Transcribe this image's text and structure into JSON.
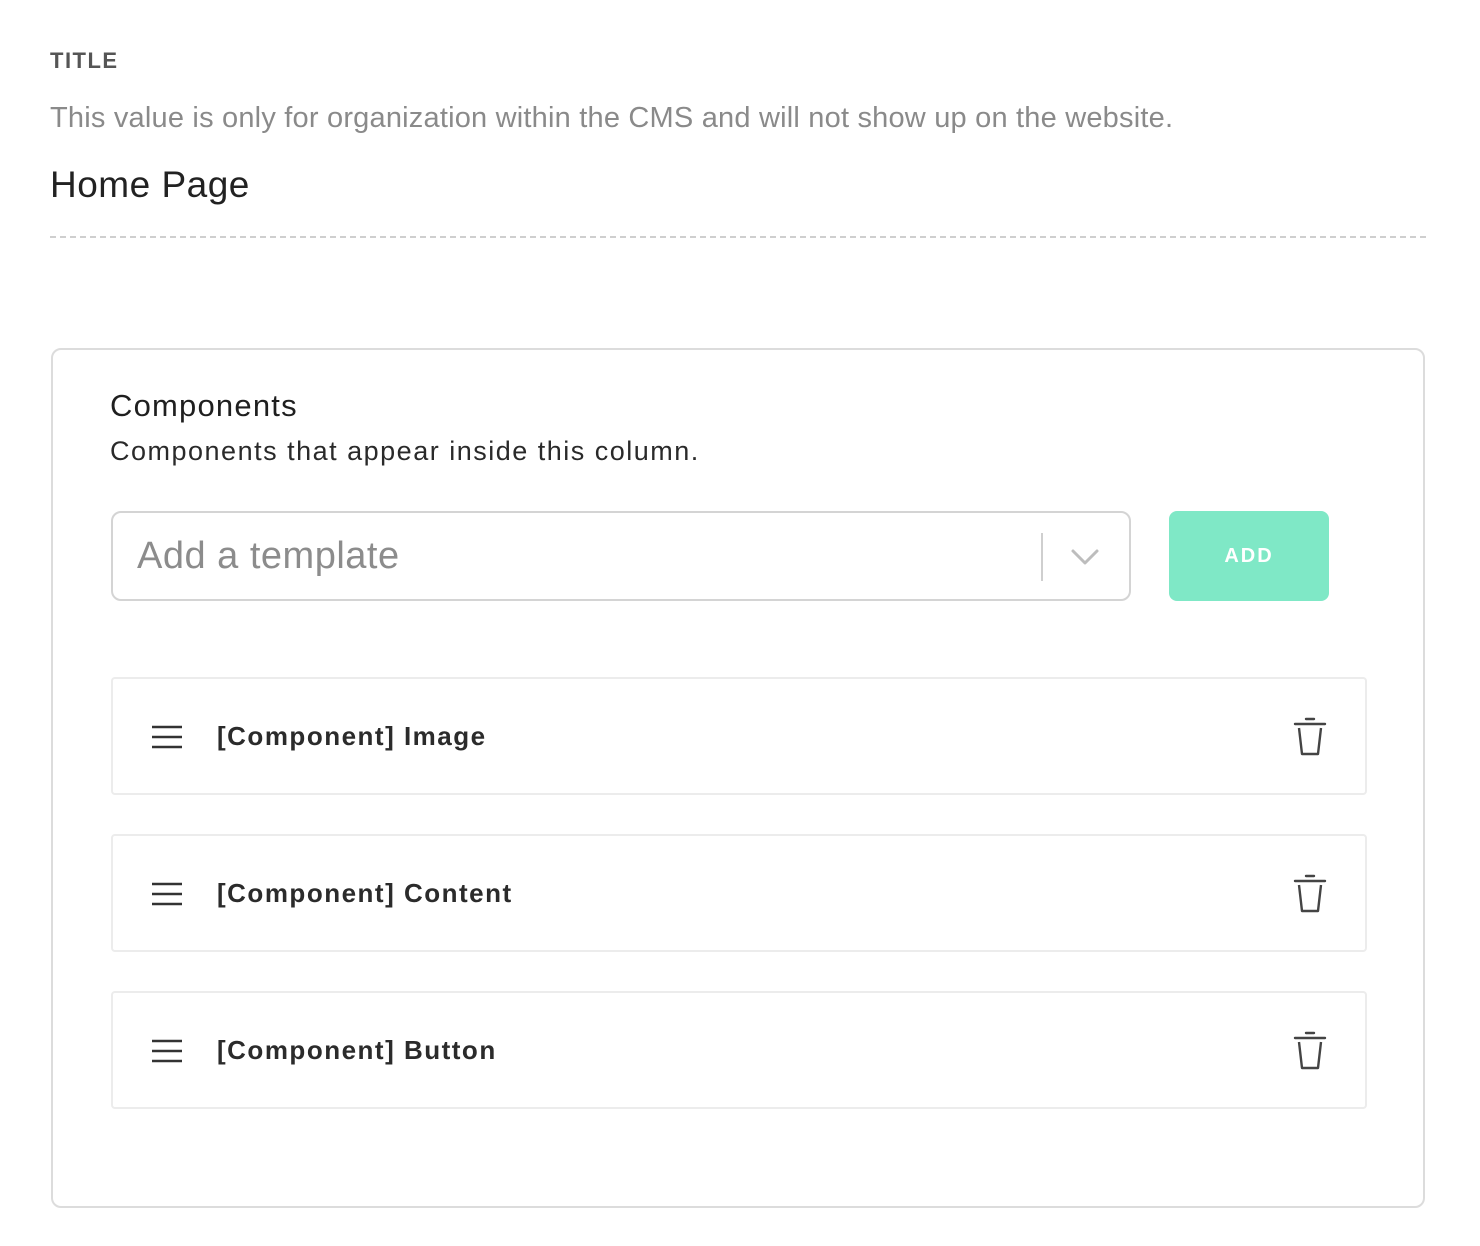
{
  "title_field": {
    "label": "TITLE",
    "help_text": "This value is only for organization within the CMS and will not show up on the website.",
    "value": "Home Page"
  },
  "components": {
    "heading": "Components",
    "description": "Components that appear inside this column.",
    "template_select": {
      "placeholder": "Add a template",
      "icon": "chevron-down-icon"
    },
    "add_button": {
      "label": "ADD",
      "color": "#7fe8c6"
    },
    "items": [
      {
        "label": "[Component] Image",
        "drag_icon": "drag-handle-icon",
        "delete_icon": "trash-icon"
      },
      {
        "label": "[Component] Content",
        "drag_icon": "drag-handle-icon",
        "delete_icon": "trash-icon"
      },
      {
        "label": "[Component] Button",
        "drag_icon": "drag-handle-icon",
        "delete_icon": "trash-icon"
      }
    ]
  }
}
